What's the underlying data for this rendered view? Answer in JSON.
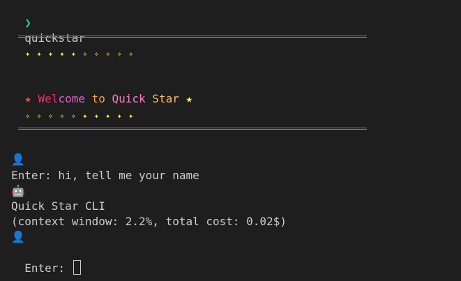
{
  "header": {
    "arrow": "❯",
    "command": "quickstar"
  },
  "banner": {
    "stars_top": "✦ ✦ ✦ ✦ ✦ ✧ ✧ ✧ ✧ ✧",
    "stars_bottom": "✧ ✧ ✧ ✧ ✧ ✦ ✦ ✦ ✦ ✦",
    "star_left": "★",
    "title_segments": [
      {
        "text": " Wel",
        "color": "#f92672"
      },
      {
        "text": "come",
        "color": "#e060c8"
      },
      {
        "text": " to ",
        "color": "#ff9f43"
      },
      {
        "text": "Quick",
        "color": "#ff79c6"
      },
      {
        "text": " Star",
        "color": "#ffb86c"
      },
      {
        "text": " ★",
        "color": "#f5f543"
      }
    ],
    "star_left_color": "#f44747"
  },
  "transcript": {
    "user_icon_1": "👤",
    "user_line_1": "Enter: hi, tell me your name",
    "bot_icon": "🤖",
    "bot_line_1": "Quick Star CLI",
    "bot_line_2": "(context window: 2.2%, total cost: 0.02$)",
    "user_icon_2": "👤",
    "input_prompt": "Enter: "
  }
}
